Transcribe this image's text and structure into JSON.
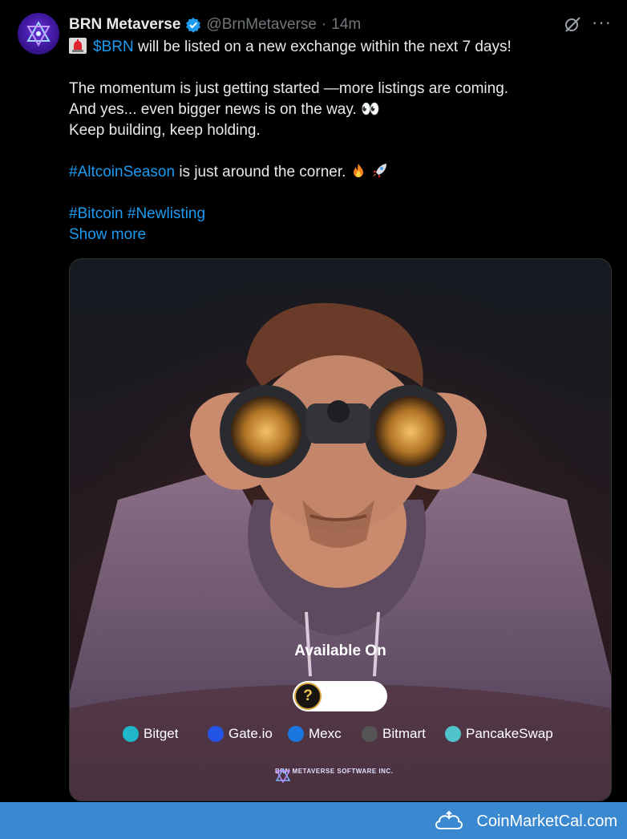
{
  "account": {
    "name": "BRN Metaverse",
    "handle": "@BrnMetaverse",
    "separator": "·",
    "time": "14m"
  },
  "icons": {
    "verified": "verified-badge-icon",
    "grok": "grok-icon",
    "more": "more-options-icon",
    "siren": "rotating-light-icon",
    "eyes": "eyes-icon",
    "fire": "fire-icon",
    "rocket": "rocket-icon"
  },
  "tweet": {
    "line1_ticker": "$BRN",
    "line1_text": " will be listed on a new exchange within the next 7 days!",
    "line2": "The momentum is just getting started —more listings are coming.",
    "line3": "And yes... even bigger news is on the way. ",
    "line4": "Keep building, keep holding.",
    "line5_tag": "#AltcoinSeason",
    "line5_text": "  is just around the corner. ",
    "line6_tag1": "#Bitcoin",
    "line6_tag2": "#Newlisting",
    "show_more": "Show more",
    "eyes_emoji": "👀"
  },
  "media": {
    "available_title": "Available On",
    "question_mark": "?",
    "exchanges": [
      "Bitget",
      "Gate.io",
      "Mexc",
      "Bitmart",
      "PancakeSwap"
    ],
    "footer": "BRN METAVERSE SOFTWARE INC."
  },
  "watermark": {
    "text": "CoinMarketCal.com"
  },
  "colors": {
    "link": "#1d9bf0",
    "background": "#000000",
    "watermark_bar": "#3a88d0",
    "verified": "#1d9bf0"
  }
}
